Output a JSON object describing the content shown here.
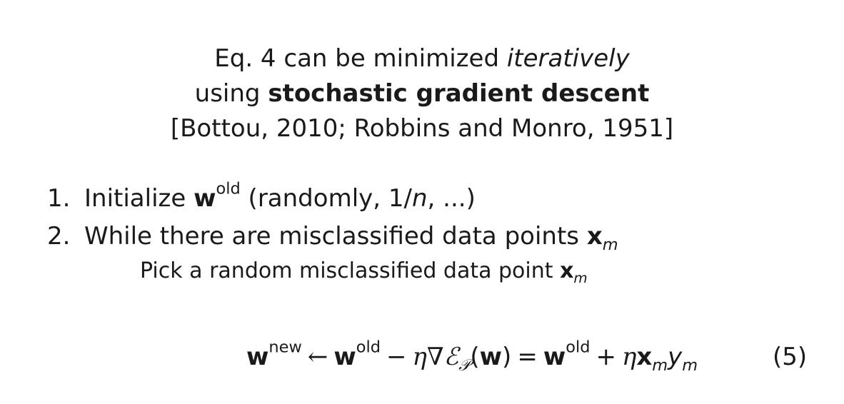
{
  "intro": {
    "line1_prefix": "Eq. 4 can be minimized ",
    "line1_emph": "iteratively",
    "line2_prefix": "using ",
    "line2_strong": "stochastic gradient descent",
    "line3": "[Bottou, 2010; Robbins and Monro, 1951]"
  },
  "steps": [
    {
      "number": "1.",
      "text_before": "Initialize ",
      "vector": "w",
      "superscript": "old",
      "text_after": " (randomly, 1/",
      "italic": "n",
      "text_end": ", ...)"
    },
    {
      "number": "2.",
      "text": "While there are misclassified data points ",
      "vector": "x",
      "subscript": "m"
    }
  ],
  "sub_step": {
    "text": "Pick a random misclassified data point ",
    "vector": "x",
    "subscript": "m"
  },
  "equation": {
    "w": "w",
    "new": "new",
    "old": "old",
    "arrow": "←",
    "minus": "−",
    "eta": "η",
    "nabla": "∇",
    "E": "ℰ",
    "P": "𝒫",
    "lparen": "(",
    "rparen": ")",
    "equals": "=",
    "plus": "+",
    "x": "x",
    "m": "m",
    "y": "y",
    "number": "(5)"
  }
}
